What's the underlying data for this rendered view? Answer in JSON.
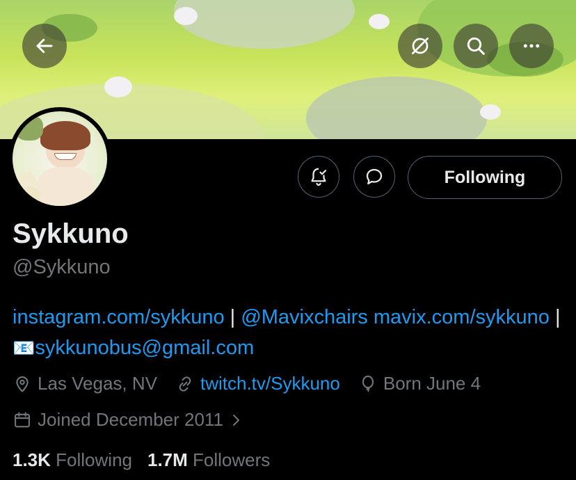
{
  "header": {
    "back_icon": "back-arrow-icon",
    "translate_icon": "translate-slash-icon",
    "search_icon": "search-icon",
    "more_icon": "more-icon"
  },
  "profile": {
    "display_name": "Sykkuno",
    "handle": "@Sykkuno",
    "bio": {
      "link1": "instagram.com/sykkuno",
      "sep1": " | ",
      "mention": "@Mavixchairs",
      "link2": " mavix.com/sykkuno",
      "sep2": " | ",
      "email_icon": "📧",
      "email": "sykkunobus@gmail.com"
    },
    "location": "Las Vegas, NV",
    "website": "twitch.tv/Sykkuno",
    "birthday": "Born June 4",
    "joined": "Joined December 2011",
    "following_count": "1.3K",
    "following_label": "Following",
    "followers_count": "1.7M",
    "followers_label": "Followers"
  },
  "actions": {
    "notify_icon": "bell-check-icon",
    "message_icon": "message-bubble-icon",
    "following_button": "Following"
  },
  "colors": {
    "accent": "#1d9bf0",
    "muted": "#71767b",
    "text": "#e7e9ea",
    "background": "#000000",
    "border": "#536471"
  }
}
